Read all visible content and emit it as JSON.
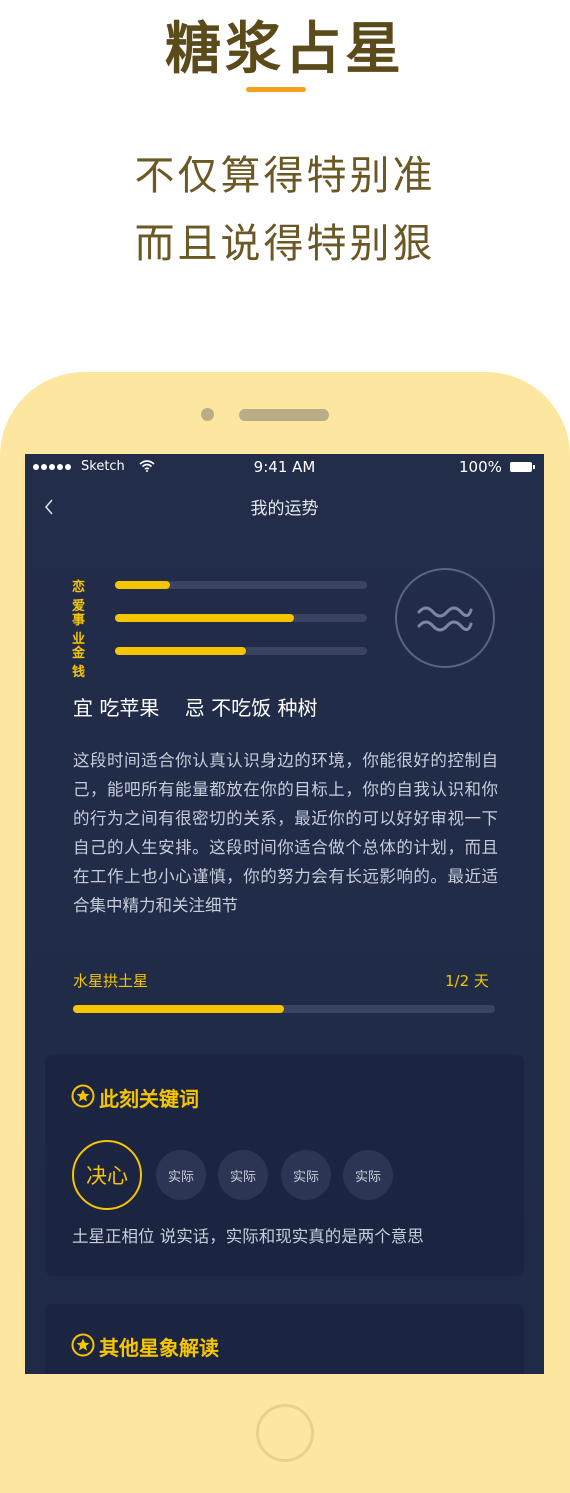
{
  "hero": {
    "title": "糖浆占星",
    "subtitle_line1": "不仅算得特别准",
    "subtitle_line2": "而且说得特别狠",
    "accent_color": "#f5a01e"
  },
  "status_bar": {
    "carrier": "Sketch",
    "time": "9:41 AM",
    "battery": "100%"
  },
  "nav": {
    "back_icon": "chevron-left-icon",
    "title": "我的运势"
  },
  "fortune": {
    "bars": [
      {
        "label": "恋爱",
        "level": 0.22
      },
      {
        "label": "事业",
        "level": 0.71
      },
      {
        "label": "金钱",
        "level": 0.52
      }
    ],
    "zodiac_icon": "aquarius-icon",
    "do_dont": "宜 吃苹果    忌 不吃饭 种树",
    "description": "这段时间适合你认真认识身边的环境，你能很好的控制自己，能吧所有能量都放在你的目标上，你的自我认识和你的行为之间有很密切的关系，最近你的可以好好审视一下自己的人生安排。这段时间你适合做个总体的计划，而且在工作上也小心谨慎，你的努力会有长远影响的。最近适合集中精力和关注细节"
  },
  "transit": {
    "label": "水星拱土星",
    "days": "1/2 天",
    "progress": 0.5
  },
  "keywords_card": {
    "title": "此刻关键词",
    "main_keyword": "决心",
    "other_keywords": [
      "实际",
      "实际",
      "实际",
      "实际"
    ],
    "note": "土星正相位 说实话，实际和现实真的是两个意思"
  },
  "other_card": {
    "title": "其他星象解读"
  },
  "colors": {
    "accent": "#f5c500",
    "screen_bg": "#222d4a",
    "card_bg": "#1b2440",
    "phone_frame": "#fde6a0",
    "hero_text": "#5b4a1a"
  }
}
